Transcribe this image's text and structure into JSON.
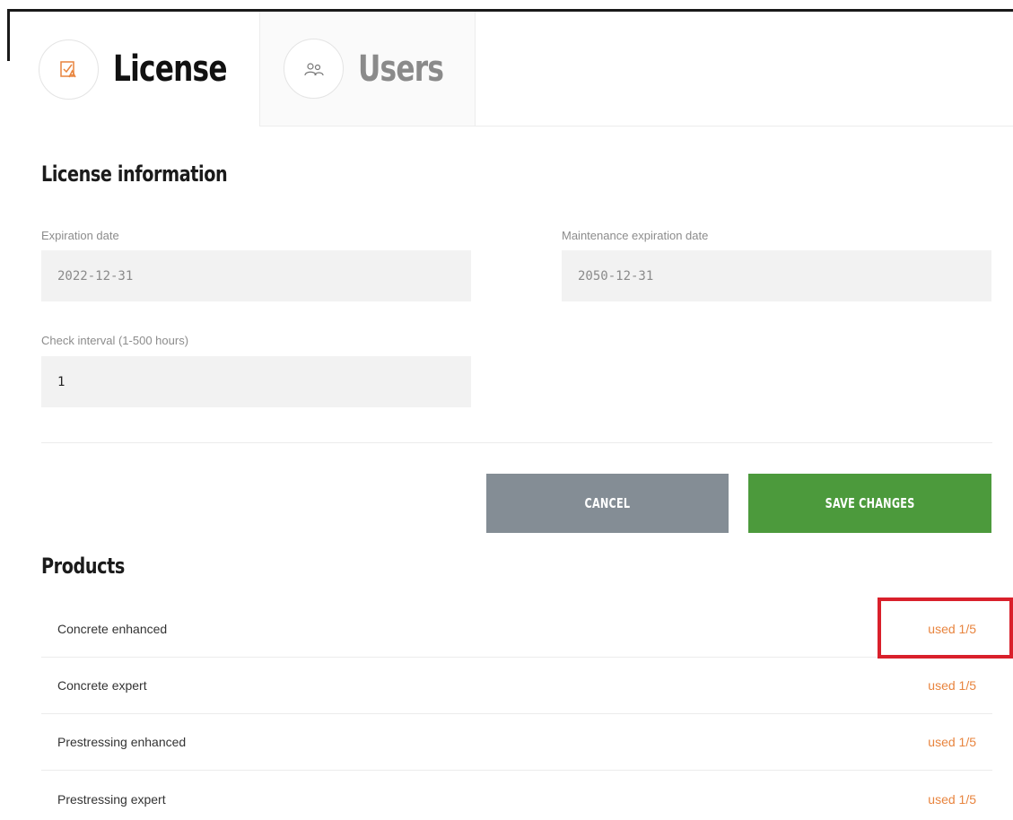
{
  "tabs": [
    {
      "label": "License",
      "icon": "license-icon",
      "active": true
    },
    {
      "label": "Users",
      "icon": "users-icon",
      "active": false
    }
  ],
  "license_info": {
    "title": "License information",
    "expiration": {
      "label": "Expiration date",
      "value": "2022-12-31"
    },
    "maintenance": {
      "label": "Maintenance expiration date",
      "value": "2050-12-31"
    },
    "interval": {
      "label": "Check interval (1-500 hours)",
      "value": "1"
    }
  },
  "buttons": {
    "cancel": "CANCEL",
    "save": "SAVE CHANGES"
  },
  "products": {
    "title": "Products",
    "items": [
      {
        "name": "Concrete enhanced",
        "usage": "used 1/5"
      },
      {
        "name": "Concrete expert",
        "usage": "used 1/5"
      },
      {
        "name": "Prestressing enhanced",
        "usage": "used 1/5"
      },
      {
        "name": "Prestressing expert",
        "usage": "used 1/5"
      }
    ]
  },
  "colors": {
    "accent_orange": "#e8843e",
    "save_green": "#4c9a3c",
    "cancel_gray": "#848d95",
    "highlight_red": "#d9202b"
  }
}
